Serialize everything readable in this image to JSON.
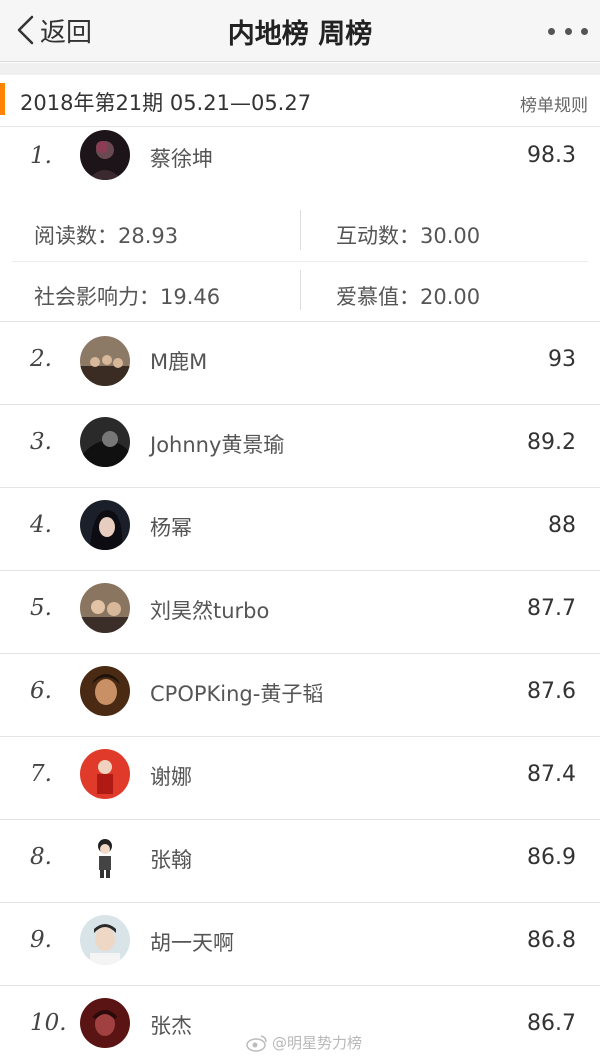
{
  "nav": {
    "back_label": "返回",
    "title": "内地榜 周榜",
    "more_icon": "more-dots-icon"
  },
  "colors": {
    "accent": "#ff8200"
  },
  "period": {
    "label": "2018年第21期  05.21—05.27",
    "rules_link": "榜单规则"
  },
  "ranking": [
    {
      "rank": "1.",
      "name": "蔡徐坤",
      "score": "98.3"
    },
    {
      "rank": "2.",
      "name": "M鹿M",
      "score": "93"
    },
    {
      "rank": "3.",
      "name": "Johnny黄景瑜",
      "score": "89.2"
    },
    {
      "rank": "4.",
      "name": "杨幂",
      "score": "88"
    },
    {
      "rank": "5.",
      "name": "刘昊然turbo",
      "score": "87.7"
    },
    {
      "rank": "6.",
      "name": "CPOPKing-黄子韬",
      "score": "87.6"
    },
    {
      "rank": "7.",
      "name": "谢娜",
      "score": "87.4"
    },
    {
      "rank": "8.",
      "name": "张翰",
      "score": "86.9"
    },
    {
      "rank": "9.",
      "name": "胡一天啊",
      "score": "86.8"
    },
    {
      "rank": "10.",
      "name": "张杰",
      "score": "86.7"
    }
  ],
  "stats": {
    "reads": "阅读数：28.93",
    "interactions": "互动数：30.00",
    "influence": "社会影响力：19.46",
    "love": "爱慕值：20.00"
  },
  "watermark": "@明星势力榜"
}
